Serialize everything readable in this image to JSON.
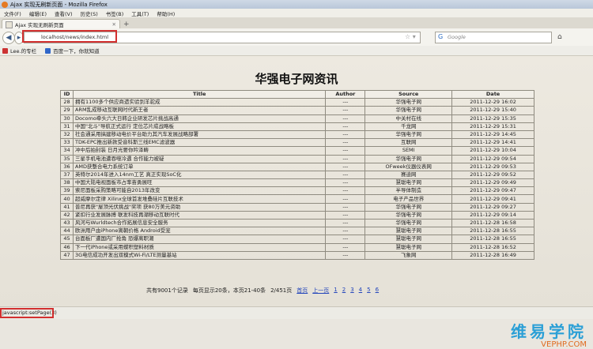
{
  "window": {
    "title": "Ajax 实现无刷新页面 - Mozilla Firefox"
  },
  "menu": [
    "文件(F)",
    "编辑(E)",
    "查看(V)",
    "历史(S)",
    "书签(B)",
    "工具(T)",
    "帮助(H)"
  ],
  "tab": {
    "label": "Ajax 实现无刷新页面"
  },
  "address": {
    "url": "localhost/news/index.html"
  },
  "search": {
    "placeholder": "Google"
  },
  "bookmarks": [
    {
      "label": "Lee.的专栏"
    },
    {
      "label": "百度一下，你就知道"
    }
  ],
  "page": {
    "heading": "华强电子网资讯",
    "columns": [
      "ID",
      "Title",
      "Author",
      "Source",
      "Date"
    ],
    "rows": [
      [
        "28",
        "拥有1100多个供应商遗实验到羊驼成",
        "---",
        "华强电子网",
        "2011-12-29 16:02"
      ],
      [
        "29",
        "ARM乱成移动互联网时代新王者",
        "---",
        "华强电子网",
        "2011-12-29 15:40"
      ],
      [
        "30",
        "Docomo牵头六大日韩企业研发芯片挑战高通",
        "---",
        "中关村在线",
        "2011-12-29 15:35"
      ],
      [
        "31",
        "中国\"北斗\"导航正式运行 定位芯片成战略板",
        "---",
        "千龙网",
        "2011-12-29 15:31"
      ],
      [
        "32",
        "社会通采用搞建移动电价平台助力其汽车发展战略部署",
        "---",
        "华强电子网",
        "2011-12-29 14:45"
      ],
      [
        "33",
        "TDK-EPC推出新款受音科斯三线EMC滤波器",
        "---",
        "互联网",
        "2011-12-29 14:41"
      ],
      [
        "34",
        "冲中后拍封装 日月光要你吟泽畴",
        "---",
        "SEMI",
        "2011-12-29 10:04"
      ],
      [
        "35",
        "三星手机电池遭吞噬冷遇 合作能力被疑",
        "---",
        "华强电子网",
        "2011-12-29 09:54"
      ],
      [
        "36",
        "AMD获整合电力系统订单",
        "---",
        "OFweek仪器仪表网",
        "2011-12-29 09:53"
      ],
      [
        "37",
        "英特尔2014年进入14nm工艺 真正实现SoC化",
        "---",
        "赛迪网",
        "2011-12-29 09:52"
      ],
      [
        "38",
        "中国大陆电视面板市占率奋勇展旺",
        "---",
        "慧聪电子网",
        "2011-12-29 09:49"
      ],
      [
        "39",
        "索尼面板采购策略可能自2013年改变",
        "---",
        "半导体制造",
        "2011-12-29 09:47"
      ],
      [
        "40",
        "超威摩尔定律 Xilinx全球首发堆叠硅片互联技术",
        "---",
        "电子产品世界",
        "2011-12-29 09:41"
      ],
      [
        "41",
        "普尼再获\"屋顶光伏挑战\"奖项 获80万美元资助",
        "---",
        "华强电子网",
        "2011-12-29 09:27"
      ],
      [
        "42",
        "紧扣行业发展脉搏 联发科技再潮移动互联时代",
        "---",
        "华强电子网",
        "2011-12-29 09:14"
      ],
      [
        "43",
        "风河与Wurldtech合作拓展信息安全服务",
        "---",
        "华强电子网",
        "2011-12-28 16:58"
      ],
      [
        "44",
        "欧洲用户由iPhone离朝价格 Android受宠",
        "---",
        "慧聪电子网",
        "2011-12-28 16:55"
      ],
      [
        "45",
        "台面板厂遭国内厂抢角 恐爆离职潮",
        "---",
        "慧聪电子网",
        "2011-12-28 16:55"
      ],
      [
        "46",
        "下一代iPhone或采用蝶积塑料材质",
        "---",
        "慧聪电子网",
        "2011-12-28 16:52"
      ],
      [
        "47",
        "3G电信成功开发出双模式Wi-Fi/LTE测量基站",
        "---",
        "飞象网",
        "2011-12-28 16:49"
      ]
    ],
    "pager": {
      "total": "共有9001个记录",
      "per_page": "每页显示20条，本页21-40条",
      "page_count": "2/451页",
      "first": "首页",
      "prev": "上一页",
      "pages": [
        "1",
        "2",
        "3",
        "4",
        "5",
        "6"
      ]
    }
  },
  "status": {
    "text": "javascript:setPage(3)"
  },
  "watermark": {
    "cn": "维易学院",
    "en": "VEPHP.COM"
  }
}
